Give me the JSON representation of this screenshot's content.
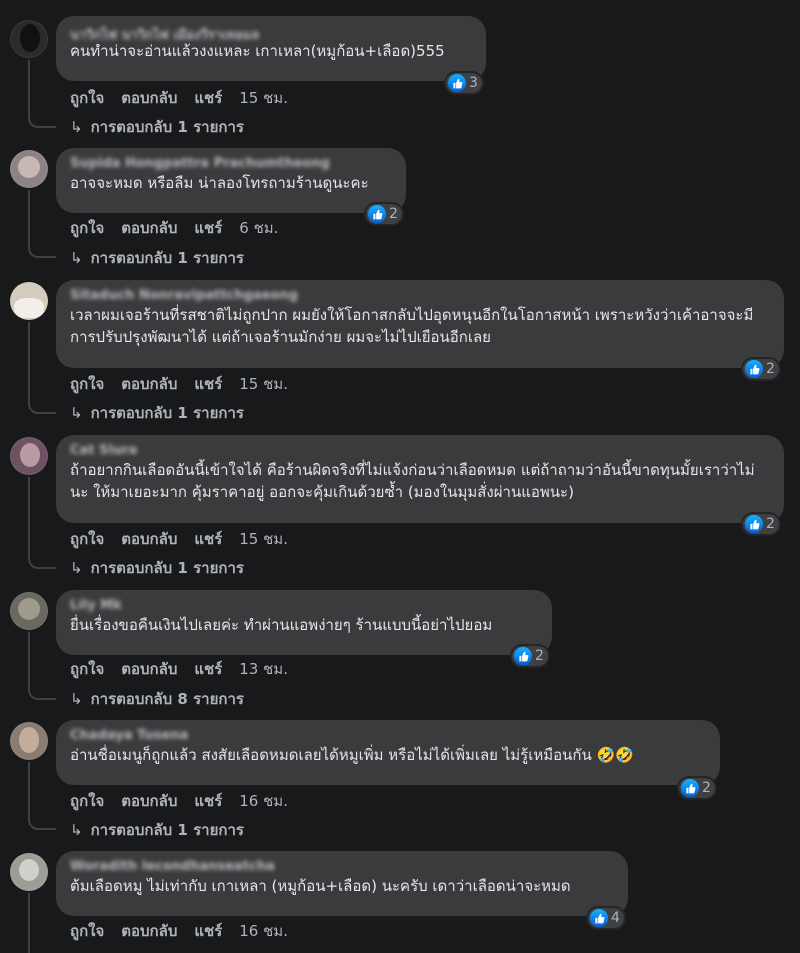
{
  "labels": {
    "like": "ถูกใจ",
    "reply": "ตอบกลับ",
    "share": "แชร์"
  },
  "comments": [
    {
      "author": "นาวิกไฟ นาวิกไฟ เมืองวีราเทอมล",
      "text": "คนทำน่าจะอ่านแล้วงงแหละ เกาเหลา(หมูก้อน+เลือด)555",
      "reactions": "3",
      "time": "15 ชม.",
      "replies": "การตอบกลับ 1 รายการ",
      "avatar_color": "#2a2a2a"
    },
    {
      "author": "Supida Hongpattra Prachumtheong",
      "text": "อาจจะหมด หรือลืม น่าลองโทรถามร้านดูนะคะ",
      "reactions": "2",
      "time": "6 ชม.",
      "replies": "การตอบกลับ 1 รายการ",
      "avatar_color": "#8a7e80"
    },
    {
      "author": "Sitaduch Nonravipattchgaeong",
      "text": "เวลาผมเจอร้านที่รสชาติไม่ถูกปาก ผมยังให้โอกาสกลับไปอุดหนุนอีกในโอกาสหน้า เพราะหวังว่าเค้าอาจจะมีการปรับปรุงพัฒนาได้ แต่ถ้าเจอร้านมักง่าย ผมจะไม่ไปเยือนอีกเลย",
      "reactions": "2",
      "time": "15 ชม.",
      "replies": "การตอบกลับ 1 รายการ",
      "avatar_color": "#c9bfb4"
    },
    {
      "author": "Cat Slura",
      "text": "ถ้าอยากกินเลือดอันนี้เข้าใจได้ คือร้านผิดจริงที่ไม่แจ้งก่อนว่าเลือดหมด แต่ถ้าถามว่าอันนี้ขาดทุนมั้ยเราว่าไม่นะ ให้มาเยอะมาก คุ้มราคาอยู่ ออกจะคุ้มเกินด้วยซ้ำ (มองในมุมสั่งผ่านแอพนะ)",
      "reactions": "2",
      "time": "15 ชม.",
      "replies": "การตอบกลับ 1 รายการ",
      "avatar_color": "#7b5a6a"
    },
    {
      "author": "Lily Mk",
      "text": "ยื่นเรื่องขอคืนเงินไปเลยค่ะ ทำผ่านแอพง่ายๆ ร้านแบบนี้อย่าไปยอม",
      "reactions": "2",
      "time": "13 ชม.",
      "replies": "การตอบกลับ 8 รายการ",
      "avatar_color": "#6b6a62"
    },
    {
      "author": "Chadaya Tusena",
      "text": "อ่านชื่อเมนูก็ถูกแล้ว สงสัยเลือดหมดเลยได้หมูเพิ่ม หรือไม่ได้เพิ่มเลย ไม่รู้เหมือนกัน 🤣🤣",
      "reactions": "2",
      "time": "16 ชม.",
      "replies": "การตอบกลับ 1 รายการ",
      "avatar_color": "#8a7d73"
    },
    {
      "author": "Woradith lecondhanseatcha",
      "text": "ต้มเลือดหมู ไม่เท่ากับ เกาเหลา (หมูก้อน+เลือด) นะครับ เดาว่าเลือดน่าจะหมด",
      "reactions": "4",
      "time": "16 ชม.",
      "replies": "",
      "avatar_color": "#9a9a96"
    }
  ]
}
